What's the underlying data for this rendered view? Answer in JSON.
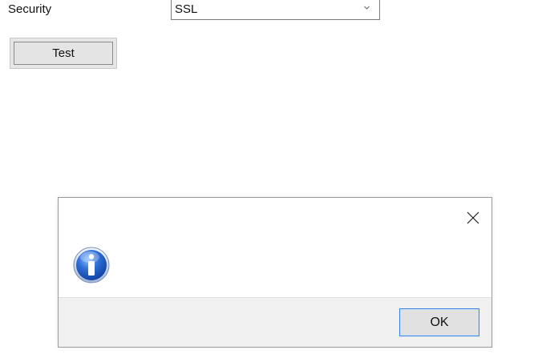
{
  "form": {
    "security_label": "Security",
    "security_value": "SSL",
    "test_button_label": "Test"
  },
  "dialog": {
    "message": "",
    "ok_label": "OK",
    "icon": "info-icon",
    "close_icon": "close-icon"
  },
  "colors": {
    "dialog_footer": "#f0f0f0",
    "ok_border": "#3b84e6",
    "button_face": "#e1e1e1"
  }
}
